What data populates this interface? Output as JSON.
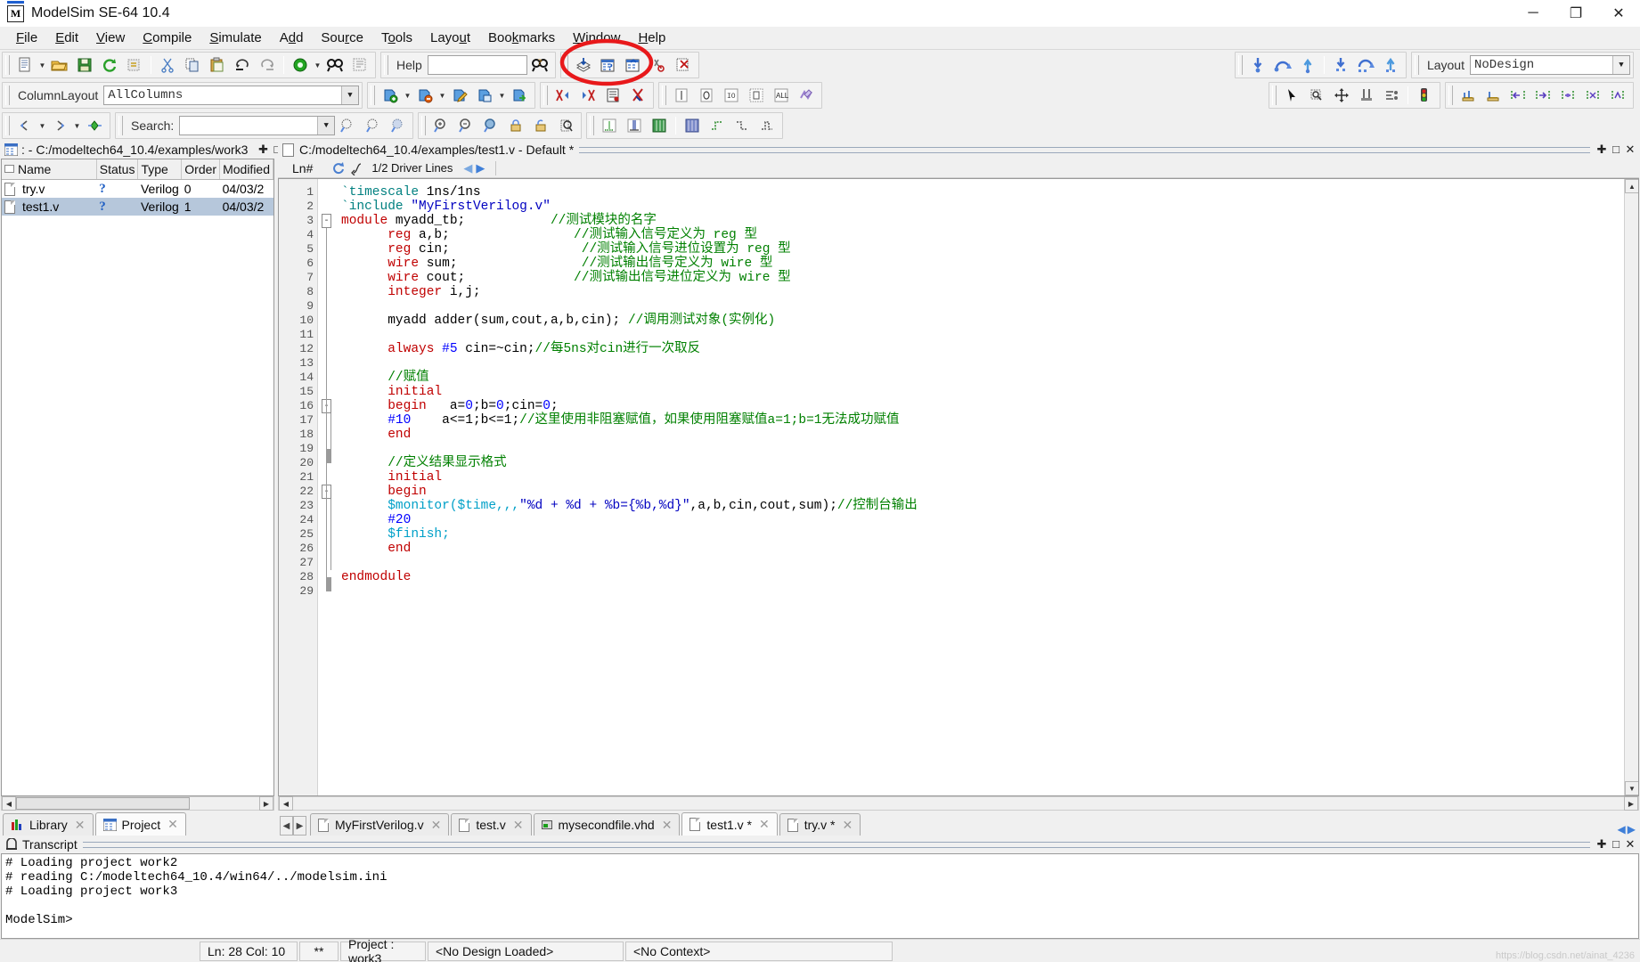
{
  "window": {
    "title": "ModelSim SE-64 10.4",
    "app_icon": "M",
    "controls": {
      "minimize": "─",
      "maximize": "❐",
      "close": "✕"
    }
  },
  "menu": {
    "items": [
      {
        "label": "File",
        "accel": "F"
      },
      {
        "label": "Edit",
        "accel": "E"
      },
      {
        "label": "View",
        "accel": "V"
      },
      {
        "label": "Compile",
        "accel": "C"
      },
      {
        "label": "Simulate",
        "accel": "S"
      },
      {
        "label": "Add",
        "accel": "d"
      },
      {
        "label": "Source",
        "accel": "r"
      },
      {
        "label": "Tools",
        "accel": "o"
      },
      {
        "label": "Layout",
        "accel": "u"
      },
      {
        "label": "Bookmarks",
        "accel": "k"
      },
      {
        "label": "Window",
        "accel": "W"
      },
      {
        "label": "Help",
        "accel": "H"
      }
    ]
  },
  "toolbar_row1": {
    "help_label": "Help",
    "help_value": "",
    "help_placeholder": "",
    "layout_label": "Layout",
    "layout_value": "NoDesign",
    "icons": [
      "new-file-icon",
      "open-folder-icon",
      "save-icon",
      "refresh-icon",
      "compile-icon",
      "cut-icon",
      "copy-icon",
      "paste-icon",
      "undo-icon",
      "redo-icon",
      "simulate-icon",
      "find-icon",
      "columns-icon",
      "help-search-icon",
      "compile-all-icon",
      "compile-unknown-icon",
      "compile-order-icon",
      "break-icon",
      "cancel-compile-icon",
      "step-into-icon",
      "step-over-icon",
      "step-out-icon",
      "run-icon",
      "continue-run-icon",
      "run-all-icon"
    ]
  },
  "toolbar_row2": {
    "columnlayout_label": "ColumnLayout",
    "columnlayout_value": "AllColumns",
    "icons": [
      "add-file-icon",
      "remove-file-icon",
      "edit-file-icon",
      "save-file-icon",
      "export-file-icon",
      "prev-bookmark-icon",
      "next-bookmark-icon",
      "list-icon",
      "clear-bookmarks-icon",
      "signal-icon",
      "clock-icon",
      "io-icon",
      "region-icon",
      "all-icon",
      "wave-icon",
      "select-mode-icon",
      "zoom-mode-icon",
      "pan-mode-icon",
      "edit-mode-icon",
      "compare-mode-icon",
      "traffic-icon",
      "run-step-icon",
      "run-continue-icon",
      "expand-left-icon",
      "expand-right-icon",
      "collapse-icon",
      "restart-icon",
      "step-icon"
    ]
  },
  "toolbar_row3": {
    "search_label": "Search:",
    "search_value": "",
    "search_placeholder": "",
    "icons": [
      "jump-prev-icon",
      "jump-next-icon",
      "goto-icon",
      "find-prev-icon",
      "find-next-icon",
      "find-all-icon",
      "zoom-in-icon",
      "zoom-out-icon",
      "zoom-full-icon",
      "lock-icon",
      "unlock-icon",
      "inspect-icon",
      "view-single-icon",
      "view-split-icon",
      "view-grid-icon",
      "wave-view-icon",
      "rise-edge-icon",
      "fall-edge-icon",
      "both-edge-icon"
    ]
  },
  "project_pane": {
    "title": ": - C:/modeltech64_10.4/examples/work3",
    "header_icon": "project-icon",
    "win_buttons": [
      "✚",
      "◰",
      "✕"
    ],
    "columns": [
      "Name",
      "Status",
      "Type",
      "Order",
      "Modified"
    ],
    "rows": [
      {
        "name": "try.v",
        "status": "?",
        "type": "Verilog",
        "order": "0",
        "modified": "04/03/2",
        "selected": false
      },
      {
        "name": "test1.v",
        "status": "?",
        "type": "Verilog",
        "order": "1",
        "modified": "04/03/2",
        "selected": true
      }
    ],
    "tabs": [
      {
        "label": "Library",
        "icon": "library-icon",
        "active": false
      },
      {
        "label": "Project",
        "icon": "project-icon",
        "active": true
      }
    ]
  },
  "editor": {
    "title": "C:/modeltech64_10.4/examples/test1.v - Default *",
    "win_buttons": [
      "✚",
      "◰",
      "✕"
    ],
    "ln_label": "Ln#",
    "driver_lines_label": "1/2 Driver Lines",
    "lines": [
      {
        "n": "1",
        "fold": "",
        "tokens": [
          {
            "t": "`timescale ",
            "c": "dir"
          },
          {
            "t": "1ns/1ns",
            "c": "plain"
          }
        ]
      },
      {
        "n": "2",
        "fold": "",
        "tokens": [
          {
            "t": "`include ",
            "c": "dir"
          },
          {
            "t": "\"MyFirstVerilog.v\"",
            "c": "str"
          }
        ]
      },
      {
        "n": "3",
        "fold": "-",
        "tokens": [
          {
            "t": "module ",
            "c": "kw"
          },
          {
            "t": "myadd_tb;",
            "c": "plain"
          },
          {
            "t": "           //测试模块的名字",
            "c": "cmt"
          }
        ]
      },
      {
        "n": "4",
        "fold": "",
        "tokens": [
          {
            "t": "      reg ",
            "c": "kw"
          },
          {
            "t": "a,b;",
            "c": "plain"
          },
          {
            "t": "                //测试输入信号定义为 reg 型",
            "c": "cmt"
          }
        ]
      },
      {
        "n": "5",
        "fold": "",
        "tokens": [
          {
            "t": "      reg ",
            "c": "kw"
          },
          {
            "t": "cin;",
            "c": "plain"
          },
          {
            "t": "                 //测试输入信号进位设置为 reg 型",
            "c": "cmt"
          }
        ]
      },
      {
        "n": "6",
        "fold": "",
        "tokens": [
          {
            "t": "      wire ",
            "c": "kw"
          },
          {
            "t": "sum;",
            "c": "plain"
          },
          {
            "t": "                //测试输出信号定义为 wire 型",
            "c": "cmt"
          }
        ]
      },
      {
        "n": "7",
        "fold": "",
        "tokens": [
          {
            "t": "      wire ",
            "c": "kw"
          },
          {
            "t": "cout;",
            "c": "plain"
          },
          {
            "t": "              //测试输出信号进位定义为 wire 型",
            "c": "cmt"
          }
        ]
      },
      {
        "n": "8",
        "fold": "",
        "tokens": [
          {
            "t": "      integer ",
            "c": "kw"
          },
          {
            "t": "i,j;",
            "c": "plain"
          }
        ]
      },
      {
        "n": "9",
        "fold": "",
        "tokens": []
      },
      {
        "n": "10",
        "fold": "",
        "tokens": [
          {
            "t": "      myadd adder(sum,cout,a,b,cin); ",
            "c": "plain"
          },
          {
            "t": "//调用测试对象(实例化)",
            "c": "cmt"
          }
        ]
      },
      {
        "n": "11",
        "fold": "",
        "tokens": []
      },
      {
        "n": "12",
        "fold": "",
        "tokens": [
          {
            "t": "      always ",
            "c": "kw"
          },
          {
            "t": "#5",
            "c": "num"
          },
          {
            "t": " cin=~cin;",
            "c": "plain"
          },
          {
            "t": "//每5ns对cin进行一次取反",
            "c": "cmt"
          }
        ]
      },
      {
        "n": "13",
        "fold": "",
        "tokens": []
      },
      {
        "n": "14",
        "fold": "",
        "tokens": [
          {
            "t": "      //赋值",
            "c": "cmt"
          }
        ]
      },
      {
        "n": "15",
        "fold": "",
        "tokens": [
          {
            "t": "      initial",
            "c": "kw"
          }
        ]
      },
      {
        "n": "16",
        "fold": "-",
        "tokens": [
          {
            "t": "      begin",
            "c": "kw"
          },
          {
            "t": "   a=",
            "c": "plain"
          },
          {
            "t": "0",
            "c": "num"
          },
          {
            "t": ";b=",
            "c": "plain"
          },
          {
            "t": "0",
            "c": "num"
          },
          {
            "t": ";cin=",
            "c": "plain"
          },
          {
            "t": "0",
            "c": "num"
          },
          {
            "t": ";",
            "c": "plain"
          }
        ]
      },
      {
        "n": "17",
        "fold": "",
        "tokens": [
          {
            "t": "      #10",
            "c": "num"
          },
          {
            "t": "    a<=1;b<=1;",
            "c": "plain"
          },
          {
            "t": "//这里使用非阻塞赋值，如果使用阻塞赋值a=1;b=1无法成功赋值",
            "c": "cmt"
          }
        ]
      },
      {
        "n": "18",
        "fold": "",
        "tokens": [
          {
            "t": "      end",
            "c": "kw"
          }
        ]
      },
      {
        "n": "19",
        "fold": "",
        "tokens": []
      },
      {
        "n": "20",
        "fold": "",
        "tokens": [
          {
            "t": "      //定义结果显示格式",
            "c": "cmt"
          }
        ]
      },
      {
        "n": "21",
        "fold": "",
        "tokens": [
          {
            "t": "      initial",
            "c": "kw"
          }
        ]
      },
      {
        "n": "22",
        "fold": "-",
        "tokens": [
          {
            "t": "      begin",
            "c": "kw"
          }
        ]
      },
      {
        "n": "23",
        "fold": "",
        "tokens": [
          {
            "t": "      $monitor($time,,,",
            "c": "sys"
          },
          {
            "t": "\"%d + %d + %b={%b,%d}\"",
            "c": "str"
          },
          {
            "t": ",a,b,cin,cout,sum);",
            "c": "plain"
          },
          {
            "t": "//控制台输出",
            "c": "cmt"
          }
        ]
      },
      {
        "n": "24",
        "fold": "",
        "tokens": [
          {
            "t": "      #20",
            "c": "num"
          }
        ]
      },
      {
        "n": "25",
        "fold": "",
        "tokens": [
          {
            "t": "      $finish;",
            "c": "sys"
          }
        ]
      },
      {
        "n": "26",
        "fold": "",
        "tokens": [
          {
            "t": "      end",
            "c": "kw"
          }
        ]
      },
      {
        "n": "27",
        "fold": "",
        "tokens": []
      },
      {
        "n": "28",
        "fold": "",
        "tokens": [
          {
            "t": "endmodule",
            "c": "kw"
          }
        ]
      },
      {
        "n": "29",
        "fold": "",
        "tokens": []
      }
    ],
    "tabs": [
      {
        "label": "MyFirstVerilog.v",
        "icon": "verilog-file-icon",
        "active": false
      },
      {
        "label": "test.v",
        "icon": "verilog-file-icon",
        "active": false
      },
      {
        "label": "mysecondfile.vhd",
        "icon": "vhdl-file-icon",
        "active": false
      },
      {
        "label": "test1.v *",
        "icon": "verilog-file-icon",
        "active": true
      },
      {
        "label": "try.v *",
        "icon": "verilog-file-icon",
        "active": false
      }
    ]
  },
  "transcript": {
    "title": "Transcript",
    "win_buttons": [
      "✚",
      "◰",
      "✕"
    ],
    "lines": [
      "# Loading project work2",
      "# reading C:/modeltech64_10.4/win64/../modelsim.ini",
      "# Loading project work3",
      ""
    ],
    "prompt": "ModelSim>"
  },
  "statusbar": {
    "ln_col": "Ln:  28  Col: 10",
    "marker": "**",
    "project": "Project : work3",
    "design": "<No Design Loaded>",
    "context": "<No Context>",
    "watermark": "https://blog.csdn.net/ainat_4236"
  },
  "annotation": {
    "shape": "red-ellipse",
    "color": "#e8191b"
  }
}
